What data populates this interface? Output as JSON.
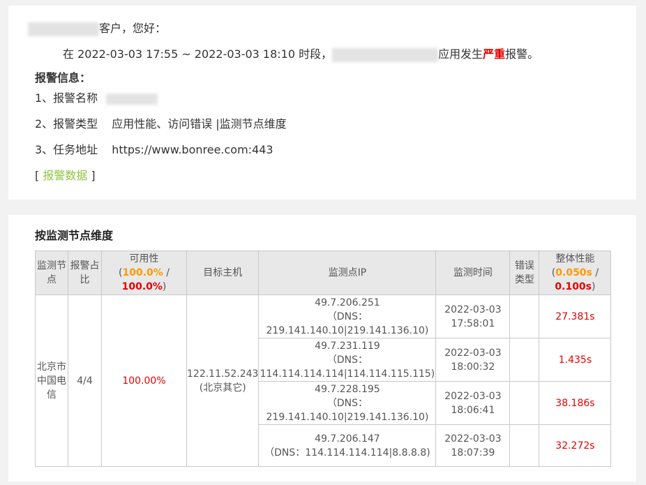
{
  "greeting": {
    "suffix": "客户，您好："
  },
  "alert_line": {
    "prefix": "在 2022-03-03 17:55 ~ 2022-03-03 18:10 时段，",
    "mid": "应用发生",
    "severity": "严重",
    "suffix": "报警。"
  },
  "info": {
    "heading": "报警信息：",
    "name_label": "1、报警名称",
    "type_label": "2、报警类型",
    "type_value": "应用性能、访问错误 |监测节点维度",
    "addr_label": "3、任务地址",
    "addr_value": "https://www.bonree.com:443",
    "link_open": "[ ",
    "link_text": "报警数据",
    "link_close": " ]"
  },
  "section": {
    "title": "按监测节点维度"
  },
  "table": {
    "headers": {
      "node": "监测节点",
      "ratio": "报警占比",
      "avail_title": "可用性",
      "avail_threshold1": "100.0%",
      "avail_sep": " / ",
      "avail_threshold2": "100.0%",
      "host": "目标主机",
      "ip": "监测点IP",
      "time": "监测时间",
      "err": "错误类型",
      "perf_title": "整体性能",
      "perf_threshold1": "0.050s",
      "perf_sep": " / ",
      "perf_threshold2": "0.100s"
    },
    "group": {
      "node": "北京市中国电信",
      "ratio": "4/4",
      "availability": "100.00%",
      "host_ip": "122.11.52.243",
      "host_name": "(北京其它)"
    },
    "rows": [
      {
        "ip": "49.7.206.251",
        "dns_open": "（DNS：",
        "dns": "219.141.140.10|219.141.136.10)",
        "date": "2022-03-03",
        "time": "17:58:01",
        "perf": "27.381s"
      },
      {
        "ip": "49.7.231.119",
        "dns_open": "（DNS：",
        "dns": "114.114.114.114|114.114.115.115)",
        "date": "2022-03-03",
        "time": "18:00:32",
        "perf": "1.435s"
      },
      {
        "ip": "49.7.228.195",
        "dns_open": "（DNS：",
        "dns": "219.141.140.10|219.141.136.10)",
        "date": "2022-03-03",
        "time": "18:06:41",
        "perf": "38.186s"
      },
      {
        "ip": "49.7.206.147",
        "dns_inline": "（DNS：114.114.114.114|8.8.8.8)",
        "date": "2022-03-03",
        "time": "18:07:39",
        "perf": "32.272s"
      }
    ]
  }
}
